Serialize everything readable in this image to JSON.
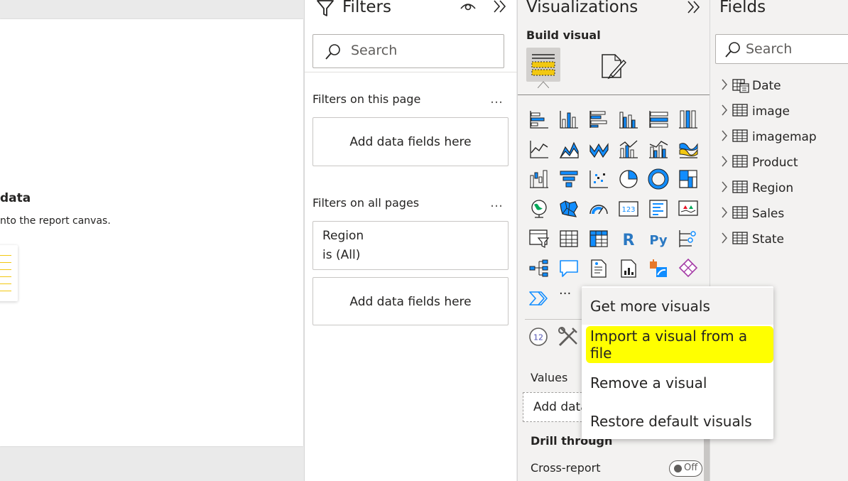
{
  "canvas": {
    "empty_title": "data",
    "empty_subtitle": "nto the report canvas."
  },
  "filters": {
    "title": "Filters",
    "search_placeholder": "Search",
    "on_this_page_label": "Filters on this page",
    "on_all_pages_label": "Filters on all pages",
    "more_options": "…",
    "add_fields_text": "Add data fields here",
    "region_card": {
      "field": "Region",
      "condition": "is (All)"
    }
  },
  "visualizations": {
    "title": "Visualizations",
    "build_visual_label": "Build visual",
    "more_visuals": "···",
    "values_label": "Values",
    "values_well_text": "Add data",
    "drill_through_label": "Drill through",
    "cross_report_label": "Cross-report",
    "cross_report_toggle": "Off",
    "r_icon_text": "R",
    "py_icon_text": "Py",
    "card_icon_text": "123",
    "kpi_icon_text": "12"
  },
  "fields": {
    "title": "Fields",
    "search_placeholder": "Search",
    "tables": [
      "Date",
      "image",
      "imagemap",
      "Product",
      "Region",
      "Sales",
      "State"
    ]
  },
  "context_menu": {
    "items": [
      "Get more visuals",
      "Import a visual from a file",
      "Remove a visual",
      "Restore default visuals"
    ]
  },
  "colors": {
    "accent_blue": "#118dff",
    "highlight_yellow": "#ffff00",
    "build_icon_yellow": "#f2c811"
  }
}
